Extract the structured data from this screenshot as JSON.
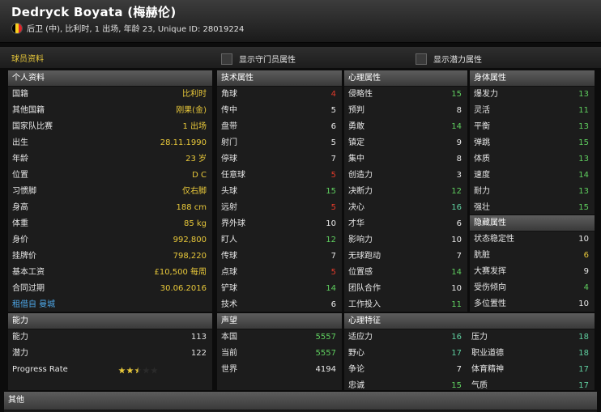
{
  "player": {
    "name": "Dedryck Boyata (梅赫伦)",
    "subtitle": "后卫 (中), 比利时, 1 出场, 年龄 23, Unique ID: 28019224",
    "flag_colors": [
      "#000000",
      "#f5d020",
      "#e0242b"
    ]
  },
  "toolbar": {
    "tab_label": "球员资料",
    "show_gk_label": "显示守门员属性",
    "show_potential_label": "显示潜力属性"
  },
  "personal": {
    "header": "个人资料",
    "rows": [
      {
        "label": "国籍",
        "value": "比利时",
        "color": "gold"
      },
      {
        "label": "其他国籍",
        "value": "刚果(金)",
        "color": "gold"
      },
      {
        "label": "国家队比赛",
        "value": "1 出场",
        "color": "gold"
      },
      {
        "label": "出生",
        "value": "28.11.1990",
        "color": "gold"
      },
      {
        "label": "年龄",
        "value": "23 岁",
        "color": "gold"
      },
      {
        "label": "位置",
        "value": "D C",
        "color": "gold"
      },
      {
        "label": "习惯脚",
        "value": "仅右脚",
        "color": "gold"
      },
      {
        "label": "身高",
        "value": "188 cm",
        "color": "gold"
      },
      {
        "label": "体重",
        "value": "85 kg",
        "color": "gold"
      },
      {
        "label": "身价",
        "value": "992,800",
        "color": "gold"
      },
      {
        "label": "挂牌价",
        "value": "798,220",
        "color": "gold"
      },
      {
        "label": "基本工资",
        "value": "£10,500 每周",
        "color": "gold"
      },
      {
        "label": "合同过期",
        "value": "30.06.2016",
        "color": "gold"
      }
    ],
    "loan_link": "租借自 曼城"
  },
  "ability": {
    "header": "能力",
    "rows": [
      {
        "label": "能力",
        "value": "113"
      },
      {
        "label": "潜力",
        "value": "122"
      }
    ],
    "progress_label": "Progress Rate",
    "progress_stars": 2.5,
    "progress_max": 5
  },
  "technical": {
    "header": "技术属性",
    "rows": [
      {
        "label": "角球",
        "value": "4",
        "color": "red"
      },
      {
        "label": "传中",
        "value": "5",
        "color": "white"
      },
      {
        "label": "盘带",
        "value": "6",
        "color": "white"
      },
      {
        "label": "射门",
        "value": "5",
        "color": "white"
      },
      {
        "label": "停球",
        "value": "7",
        "color": "white"
      },
      {
        "label": "任意球",
        "value": "5",
        "color": "red"
      },
      {
        "label": "头球",
        "value": "15",
        "color": "green"
      },
      {
        "label": "远射",
        "value": "5",
        "color": "red"
      },
      {
        "label": "界外球",
        "value": "10",
        "color": "white"
      },
      {
        "label": "盯人",
        "value": "12",
        "color": "green"
      },
      {
        "label": "传球",
        "value": "7",
        "color": "white"
      },
      {
        "label": "点球",
        "value": "5",
        "color": "red"
      },
      {
        "label": "铲球",
        "value": "14",
        "color": "green"
      },
      {
        "label": "技术",
        "value": "6",
        "color": "white"
      }
    ]
  },
  "reputation": {
    "header": "声望",
    "rows": [
      {
        "label": "本国",
        "value": "5557",
        "color": "green"
      },
      {
        "label": "当前",
        "value": "5557",
        "color": "green"
      },
      {
        "label": "世界",
        "value": "4194",
        "color": "white"
      }
    ]
  },
  "mental": {
    "header": "心理属性",
    "rows": [
      {
        "label": "侵略性",
        "value": "15",
        "color": "green"
      },
      {
        "label": "预判",
        "value": "8",
        "color": "white"
      },
      {
        "label": "勇敢",
        "value": "14",
        "color": "green"
      },
      {
        "label": "镇定",
        "value": "9",
        "color": "white"
      },
      {
        "label": "集中",
        "value": "8",
        "color": "white"
      },
      {
        "label": "创造力",
        "value": "3",
        "color": "white"
      },
      {
        "label": "决断力",
        "value": "12",
        "color": "green"
      },
      {
        "label": "决心",
        "value": "16",
        "color": "teal"
      },
      {
        "label": "才华",
        "value": "6",
        "color": "white"
      },
      {
        "label": "影响力",
        "value": "10",
        "color": "white"
      },
      {
        "label": "无球跑动",
        "value": "7",
        "color": "white"
      },
      {
        "label": "位置感",
        "value": "14",
        "color": "green"
      },
      {
        "label": "团队合作",
        "value": "10",
        "color": "white"
      },
      {
        "label": "工作投入",
        "value": "11",
        "color": "green"
      }
    ]
  },
  "traits": {
    "header": "心理特征",
    "rows": [
      {
        "label": "适应力",
        "value": "16",
        "color": "teal"
      },
      {
        "label": "野心",
        "value": "17",
        "color": "teal"
      },
      {
        "label": "争论",
        "value": "7",
        "color": "white"
      },
      {
        "label": "忠诚",
        "value": "15",
        "color": "green"
      }
    ],
    "rows2": [
      {
        "label": "压力",
        "value": "18",
        "color": "teal"
      },
      {
        "label": "职业道德",
        "value": "18",
        "color": "teal"
      },
      {
        "label": "体育精神",
        "value": "17",
        "color": "teal"
      },
      {
        "label": "气质",
        "value": "17",
        "color": "teal"
      }
    ]
  },
  "physical": {
    "header": "身体属性",
    "rows": [
      {
        "label": "爆发力",
        "value": "13",
        "color": "green"
      },
      {
        "label": "灵活",
        "value": "11",
        "color": "green"
      },
      {
        "label": "平衡",
        "value": "13",
        "color": "green"
      },
      {
        "label": "弹跳",
        "value": "15",
        "color": "green"
      },
      {
        "label": "体质",
        "value": "13",
        "color": "green"
      },
      {
        "label": "速度",
        "value": "14",
        "color": "green"
      },
      {
        "label": "耐力",
        "value": "13",
        "color": "green"
      },
      {
        "label": "强壮",
        "value": "15",
        "color": "green"
      }
    ]
  },
  "hidden": {
    "header": "隐藏属性",
    "rows": [
      {
        "label": "状态稳定性",
        "value": "10",
        "color": "white"
      },
      {
        "label": "肮脏",
        "value": "6",
        "color": "gold"
      },
      {
        "label": "大赛发挥",
        "value": "9",
        "color": "white"
      },
      {
        "label": "受伤倾向",
        "value": "4",
        "color": "green"
      },
      {
        "label": "多位置性",
        "value": "10",
        "color": "white"
      }
    ]
  },
  "other": {
    "header": "其他"
  }
}
